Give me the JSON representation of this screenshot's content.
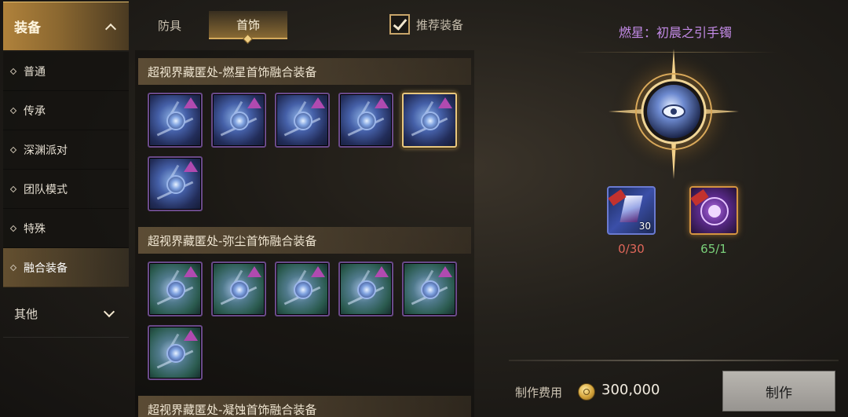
{
  "nav": {
    "header": "装备",
    "items": [
      "普通",
      "传承",
      "深渊派对",
      "团队模式",
      "特殊",
      "融合装备"
    ],
    "active_index": 5,
    "other": "其他"
  },
  "tabs": {
    "armor": "防具",
    "accessory": "首饰",
    "active": "accessory"
  },
  "recommend": {
    "label": "推荐装备",
    "checked": true
  },
  "sections": [
    {
      "title": "超视界藏匿处-燃星首饰融合装备",
      "slot_count": 6,
      "theme": "blue",
      "selected_index": 4
    },
    {
      "title": "超视界藏匿处-弥尘首饰融合装备",
      "slot_count": 6,
      "theme": "green",
      "selected_index": -1
    },
    {
      "title": "超视界藏匿处-凝蚀首饰融合装备"
    }
  ],
  "detail": {
    "title": "燃星：初晨之引手镯",
    "materials": [
      {
        "count_badge": "30",
        "progress": "0/30",
        "status_color": "#e0675a"
      },
      {
        "count_badge": "",
        "progress": "65/1",
        "status_color": "#7ad07a"
      }
    ],
    "cost_label": "制作费用",
    "cost_value": "300,000",
    "make_button": "制作"
  },
  "colors": {
    "accent_gold": "#d4aa5c",
    "title_purple": "#c48be8",
    "rarity_purple": "#b04ab0"
  }
}
